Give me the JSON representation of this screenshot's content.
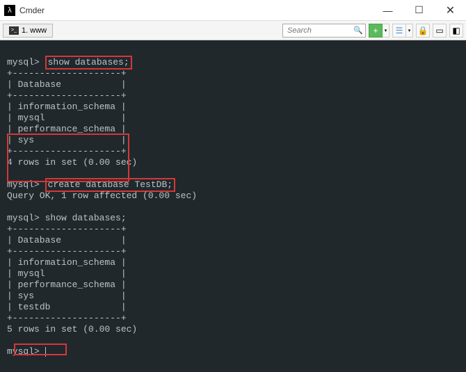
{
  "title": "Cmder",
  "tab": {
    "number": "1.",
    "label": "www"
  },
  "search": {
    "placeholder": "Search"
  },
  "prompts": {
    "p1": "mysql>",
    "p2": "mysql>",
    "p3": "mysql>",
    "p4": "mysql>"
  },
  "commands": {
    "c1": "show databases;",
    "c2": "create database TestDB;",
    "c3": "show databases;"
  },
  "border": {
    "top": "+--------------------+",
    "mid": "+--------------------+",
    "bot": "+--------------------+"
  },
  "header": "| Database           |",
  "rows1": {
    "r1": "| information_schema |",
    "r2": "| mysql              |",
    "r3": "| performance_schema |",
    "r4": "| sys                |"
  },
  "result1": "4 rows in set (0.00 sec)",
  "queryok": "Query OK, 1 row affected (0.00 sec)",
  "rows2": {
    "r1": "| information_schema |",
    "r2": "| mysql              |",
    "r3": "| performance_schema |",
    "r4": "| sys                |",
    "r5_prefix": "| ",
    "r5_hl": "testdb",
    "r5_suffix": "             |"
  },
  "result2": "5 rows in set (0.00 sec)"
}
